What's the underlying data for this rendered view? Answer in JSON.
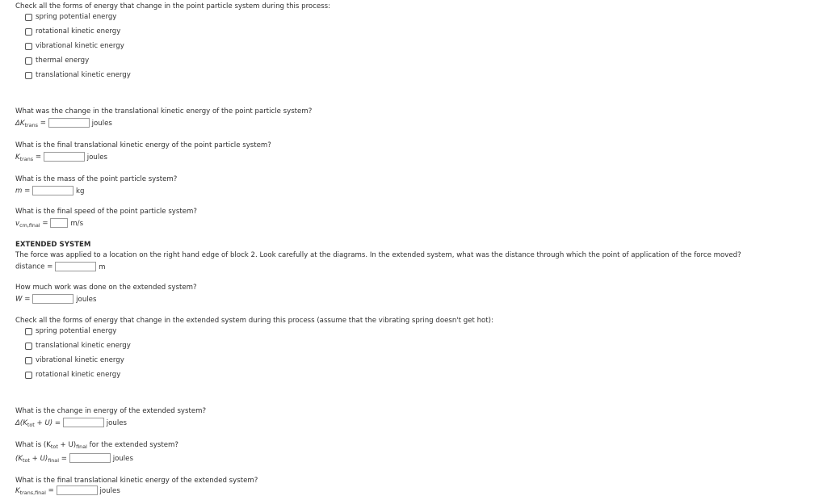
{
  "section1": {
    "question": "Check all the forms of energy that change in the point particle system during this process:",
    "options": [
      "spring potential energy",
      "rotational kinetic energy",
      "vibrational kinetic energy",
      "thermal energy",
      "translational kinetic energy"
    ]
  },
  "q_delta_ktrans": {
    "question": "What was the change in the translational kinetic energy of the point particle system?",
    "symbol": "ΔK",
    "sub": "trans",
    "eq": "=",
    "value": "",
    "unit": "joules"
  },
  "q_ktrans": {
    "question": "What is the final translational kinetic energy of the point particle system?",
    "symbol": "K",
    "sub": "trans",
    "eq": "=",
    "value": "",
    "unit": "joules"
  },
  "q_mass": {
    "question": "What is the mass of the point particle system?",
    "symbol": "m",
    "eq": "=",
    "value": "",
    "unit": "kg"
  },
  "q_vcm": {
    "question": "What is the final speed of the point particle system?",
    "symbol": "v",
    "sub": "cm,final",
    "eq": "=",
    "value": "",
    "unit": "m/s"
  },
  "extended": {
    "heading": "EXTENDED SYSTEM",
    "intro": "The force was applied to a location on the right hand edge of block 2. Look carefully at the diagrams. In the extended system, what was the distance through which the point of application of the force moved?",
    "distance_label": "distance =",
    "distance_value": "",
    "distance_unit": "m"
  },
  "q_work": {
    "question": "How much work was done on the extended system?",
    "symbol": "W",
    "eq": "=",
    "value": "",
    "unit": "joules"
  },
  "section2": {
    "question": "Check all the forms of energy that change in the extended system during this process (assume that the vibrating spring doesn't get hot):",
    "options": [
      "spring potential energy",
      "translational kinetic energy",
      "vibrational kinetic energy",
      "rotational kinetic energy"
    ]
  },
  "q_delta_ext": {
    "question": "What is the change in energy of the extended system?",
    "lhs_a": "Δ(K",
    "lhs_sub": "tot",
    "lhs_b": " + U) =",
    "value": "",
    "unit": "joules"
  },
  "q_final_ext": {
    "question_a": "What is (K",
    "question_sub1": "tot",
    "question_b": " + U)",
    "question_sub2": "final",
    "question_c": " for the extended system?",
    "lhs_a": "(K",
    "lhs_sub1": "tot",
    "lhs_b": " + U)",
    "lhs_sub2": "final",
    "lhs_c": " =",
    "value": "",
    "unit": "joules"
  },
  "q_final_trans_ext": {
    "question": "What is the final translational kinetic energy of the extended system?",
    "symbol": "K",
    "sub": "trans,final",
    "eq": "=",
    "value": "",
    "unit": "joules"
  }
}
